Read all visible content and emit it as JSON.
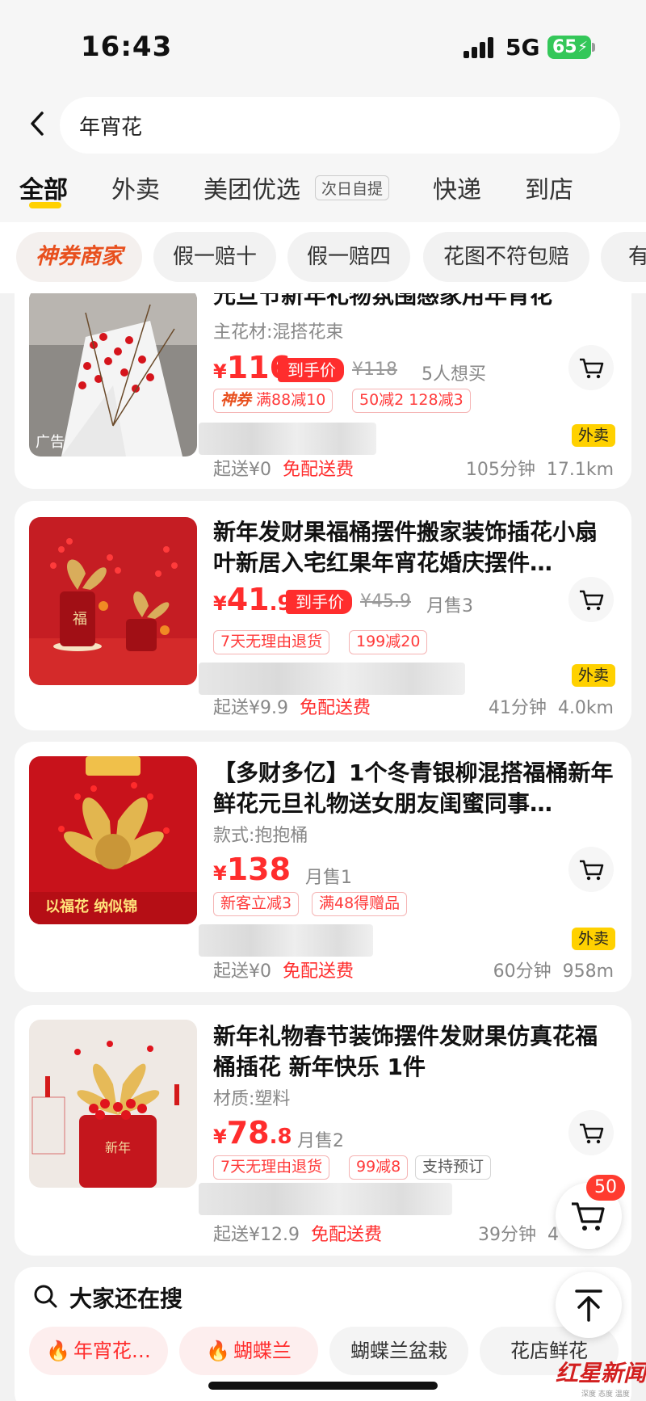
{
  "status_bar": {
    "time": "16:43",
    "network": "5G",
    "battery": "65"
  },
  "search": {
    "query": "年宵花"
  },
  "tabs": [
    {
      "label": "全部",
      "active": true
    },
    {
      "label": "外卖"
    },
    {
      "label": "美团优选",
      "badge": "次日自提"
    },
    {
      "label": "快递"
    },
    {
      "label": "到店"
    }
  ],
  "filters": [
    "神券商家",
    "假一赔十",
    "假一赔四",
    "花图不符包赔",
    "有有"
  ],
  "products": [
    {
      "title": "元旦节新年礼物氛围感家用年宵花",
      "sub": "主花材:混搭花束",
      "price_int": "116",
      "price_dec": "",
      "arrival_tag": "到手价",
      "orig_price": "¥118",
      "sold": "5人想买",
      "promos": [
        {
          "prefix": "神券",
          "text": "满88减10"
        },
        {
          "text": "50减2 128减3"
        }
      ],
      "ad_label": "广告",
      "delivery": "外卖",
      "min_order": "起送¥0",
      "free": "免配送费",
      "time": "105分钟",
      "distance": "17.1km"
    },
    {
      "title": "新年发财果福桶摆件搬家装饰插花小扇叶新居入宅红果年宵花婚庆摆件…",
      "price_int": "41",
      "price_dec": ".9",
      "arrival_tag": "到手价",
      "orig_price": "¥45.9",
      "sold": "月售3",
      "promos": [
        {
          "text": "7天无理由退货"
        },
        {
          "text": "199减20"
        }
      ],
      "delivery": "外卖",
      "min_order": "起送¥9.9",
      "free": "免配送费",
      "time": "41分钟",
      "distance": "4.0km"
    },
    {
      "title": "【多财多亿】1个冬青银柳混搭福桶新年鲜花元旦礼物送女朋友闺蜜同事…",
      "sub": "款式:抱抱桶",
      "price_int": "138",
      "price_dec": "",
      "sold": "月售1",
      "promos": [
        {
          "text": "新客立减3"
        },
        {
          "text": "满48得赠品"
        }
      ],
      "image_caption": "以福花 纳似锦",
      "delivery": "外卖",
      "min_order": "起送¥0",
      "free": "免配送费",
      "time": "60分钟",
      "distance": "958m"
    },
    {
      "title": "新年礼物春节装饰摆件发财果仿真花福桶插花 新年快乐 1件",
      "sub": "材质:塑料",
      "price_int": "78",
      "price_dec": ".8",
      "sold": "月售2",
      "promos": [
        {
          "text": "7天无理由退货"
        },
        {
          "text": "99减8"
        },
        {
          "text": "支持预订",
          "gray": true
        }
      ],
      "min_order": "起送¥12.9",
      "free": "免配送费",
      "time": "39分钟",
      "distance": "4"
    }
  ],
  "also_search": {
    "title": "大家还在搜",
    "keywords": [
      {
        "label": "年宵花…",
        "hot": true
      },
      {
        "label": "蝴蝶兰",
        "hot": true
      },
      {
        "label": "蝴蝶兰盆栽"
      },
      {
        "label": "花店鲜花"
      }
    ]
  },
  "cart": {
    "count": "50"
  },
  "watermark": {
    "main": "红星新闻",
    "sub": "深度 态度 温度"
  },
  "colors": {
    "accent_red": "#ff2d2d",
    "brand_yellow": "#ffd100"
  }
}
